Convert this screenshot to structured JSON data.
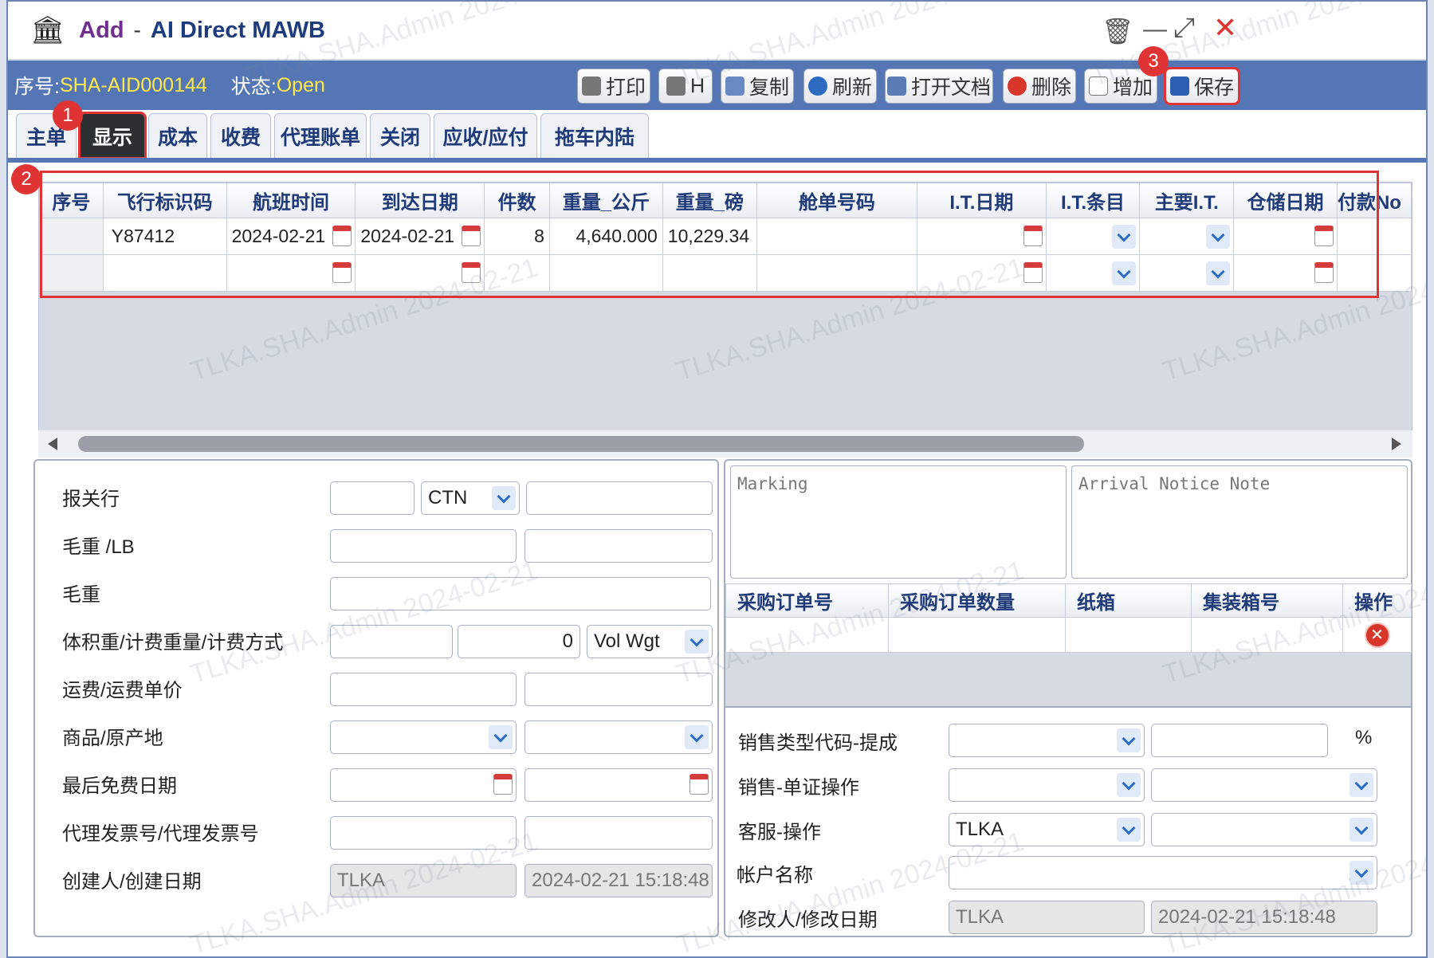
{
  "window": {
    "title_action": "Add",
    "title_sep": "-",
    "title": "AI Direct MAWB"
  },
  "header": {
    "no_label": "序号:",
    "no_value": "SHA-AID000144",
    "status_label": "状态:",
    "status_value": "Open"
  },
  "toolbar": {
    "print": "打印",
    "h": "H",
    "copy": "复制",
    "refresh": "刷新",
    "open_doc": "打开文档",
    "delete": "删除",
    "add": "增加",
    "save": "保存"
  },
  "badges": [
    "1",
    "2",
    "3"
  ],
  "tabs": [
    "主单",
    "显示",
    "成本",
    "收费",
    "代理账单",
    "关闭",
    "应收/应付",
    "拖车内陆"
  ],
  "grid": {
    "columns": [
      "序号",
      "飞行标识码",
      "航班时间",
      "到达日期",
      "件数",
      "重量_公斤",
      "重量_磅",
      "舱单号码",
      "I.T.日期",
      "I.T.条目",
      "主要I.T.",
      "仓储日期",
      "付款No"
    ],
    "rows": [
      [
        "",
        "Y87412",
        "2024-02-21",
        "2024-02-21",
        "8",
        "4,640.000",
        "10,229.34",
        "",
        "",
        "",
        "",
        "",
        ""
      ],
      [
        "",
        "",
        "",
        "",
        "",
        "",
        "",
        "",
        "",
        "",
        "",
        "",
        ""
      ]
    ]
  },
  "left_form": {
    "broker_label": "报关行",
    "broker_unit": "CTN",
    "gross_lb_label": "毛重 /LB",
    "gross_label": "毛重",
    "vol_label": "体积重/计费重量/计费方式",
    "vol_charge": "0",
    "vol_method": "Vol Wgt",
    "freight_label": "运费/运费单价",
    "commodity_label": "商品/原产地",
    "free_date_label": "最后免费日期",
    "agent_inv_label": "代理发票号/代理发票号",
    "creator_label": "创建人/创建日期",
    "creator": "TLKA",
    "create_date": "2024-02-21 15:18:48"
  },
  "right_form": {
    "marking_placeholder": "Marking",
    "arrival_placeholder": "Arrival Notice Note",
    "po_columns": [
      "采购订单号",
      "采购订单数量",
      "纸箱",
      "集装箱号",
      "操作"
    ],
    "sales_type_label": "销售类型代码-提成",
    "percent": "%",
    "sales_doc_label": "销售-单证操作",
    "cs_label": "客服-操作",
    "cs_value": "TLKA",
    "account_label": "帐户名称",
    "modifier_label": "修改人/修改日期",
    "modifier": "TLKA",
    "modify_date": "2024-02-21 15:18:48"
  },
  "watermark": "TLKA.SHA.Admin 2024-02-21"
}
